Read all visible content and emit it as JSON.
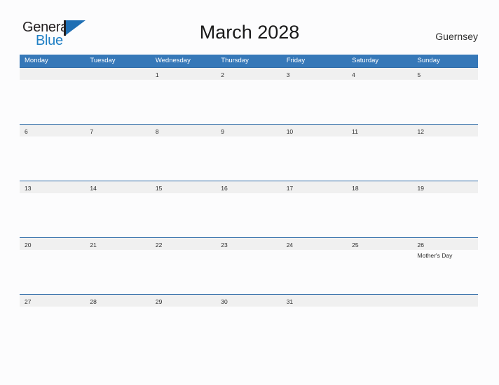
{
  "brand": {
    "name_part1": "General",
    "name_part2": "Blue",
    "colors": {
      "dark": "#231f20",
      "blue": "#1f7fc4",
      "flag": "#1f6fb4"
    }
  },
  "header": {
    "title": "March 2028",
    "locale": "Guernsey"
  },
  "calendar": {
    "colors": {
      "header_blue": "#3678b8",
      "row_line": "#2f6ca8",
      "band_gray": "#f0f0f0",
      "page_background": "#fcfcfd"
    },
    "weekdays": [
      "Monday",
      "Tuesday",
      "Wednesday",
      "Thursday",
      "Friday",
      "Saturday",
      "Sunday"
    ],
    "weeks": [
      [
        {
          "day": "",
          "event": ""
        },
        {
          "day": "",
          "event": ""
        },
        {
          "day": "1",
          "event": ""
        },
        {
          "day": "2",
          "event": ""
        },
        {
          "day": "3",
          "event": ""
        },
        {
          "day": "4",
          "event": ""
        },
        {
          "day": "5",
          "event": ""
        }
      ],
      [
        {
          "day": "6",
          "event": ""
        },
        {
          "day": "7",
          "event": ""
        },
        {
          "day": "8",
          "event": ""
        },
        {
          "day": "9",
          "event": ""
        },
        {
          "day": "10",
          "event": ""
        },
        {
          "day": "11",
          "event": ""
        },
        {
          "day": "12",
          "event": ""
        }
      ],
      [
        {
          "day": "13",
          "event": ""
        },
        {
          "day": "14",
          "event": ""
        },
        {
          "day": "15",
          "event": ""
        },
        {
          "day": "16",
          "event": ""
        },
        {
          "day": "17",
          "event": ""
        },
        {
          "day": "18",
          "event": ""
        },
        {
          "day": "19",
          "event": ""
        }
      ],
      [
        {
          "day": "20",
          "event": ""
        },
        {
          "day": "21",
          "event": ""
        },
        {
          "day": "22",
          "event": ""
        },
        {
          "day": "23",
          "event": ""
        },
        {
          "day": "24",
          "event": ""
        },
        {
          "day": "25",
          "event": ""
        },
        {
          "day": "26",
          "event": "Mother's Day"
        }
      ],
      [
        {
          "day": "27",
          "event": ""
        },
        {
          "day": "28",
          "event": ""
        },
        {
          "day": "29",
          "event": ""
        },
        {
          "day": "30",
          "event": ""
        },
        {
          "day": "31",
          "event": ""
        },
        {
          "day": "",
          "event": ""
        },
        {
          "day": "",
          "event": ""
        }
      ]
    ]
  }
}
